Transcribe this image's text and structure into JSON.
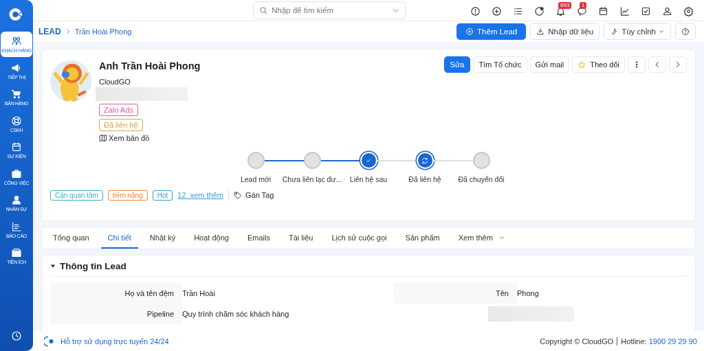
{
  "sidebar": {
    "items": [
      {
        "label": "KHÁCH HÀNG",
        "selected": true
      },
      {
        "label": "TIẾP THỊ",
        "selected": false
      },
      {
        "label": "BÁN HÀNG",
        "selected": false
      },
      {
        "label": "CSKH",
        "selected": false
      },
      {
        "label": "SỰ KIỆN",
        "selected": false
      },
      {
        "label": "CÔNG VIỆC",
        "selected": false
      },
      {
        "label": "NHÂN SỰ",
        "selected": false
      },
      {
        "label": "BÁO CÁO",
        "selected": false
      },
      {
        "label": "TIỆN ÍCH",
        "selected": false
      }
    ]
  },
  "search": {
    "placeholder": "Nhập để tìm kiếm"
  },
  "toolbar": {
    "notification_count": "693",
    "message_count": "1"
  },
  "breadcrumb": {
    "root": "LEAD",
    "current": "Trần Hoài Phong"
  },
  "page_actions": [
    {
      "label": "Thêm Lead",
      "kind": "primary"
    },
    {
      "label": "Nhập dữ liệu",
      "kind": "plain"
    },
    {
      "label": "Tùy chỉnh",
      "kind": "menu"
    },
    {
      "kind": "help"
    }
  ],
  "lead": {
    "name": "Anh Trần Hoài Phong",
    "company": "CloudGO",
    "badges": [
      {
        "label": "Zalo Ads",
        "color": "#d9609a"
      },
      {
        "label": "Đã liên hệ",
        "color": "#d9a441"
      }
    ],
    "map_link": "Xem bản đồ",
    "actions": [
      {
        "label": "Sửa",
        "kind": "primary"
      },
      {
        "label": "Tìm Tổ chức",
        "kind": "plain"
      },
      {
        "label": "Gửi mail",
        "kind": "plain"
      },
      {
        "label": "Theo dõi",
        "kind": "star"
      },
      {
        "kind": "more"
      },
      {
        "kind": "prev"
      },
      {
        "kind": "next"
      }
    ],
    "stages": [
      {
        "label": "Lead mới",
        "kind": "passed"
      },
      {
        "label": "Chưa liên lạc đư...",
        "kind": "passed"
      },
      {
        "label": "Liên hệ sau",
        "kind": "checked"
      },
      {
        "label": "Đã liên hệ",
        "kind": "active"
      },
      {
        "label": "Đã chuyển đổi",
        "kind": "pending"
      }
    ],
    "tags": [
      {
        "label": "Cần quan tâm",
        "color": "#3bb4b8"
      },
      {
        "label": "tiềm năng",
        "color": "#f08a3c"
      },
      {
        "label": "Hot",
        "color": "#3a9ec2"
      }
    ],
    "more_tags": "12  xem thêm",
    "assign_tag": "Gán Tag"
  },
  "tabs": [
    {
      "label": "Tổng quan",
      "kind": "tab",
      "selected": false
    },
    {
      "label": "Chi tiết",
      "kind": "tab",
      "selected": true
    },
    {
      "label": "Nhật ký",
      "kind": "tab",
      "selected": false
    },
    {
      "label": "Hoạt động",
      "kind": "tab",
      "selected": false
    },
    {
      "label": "Emails",
      "kind": "tab",
      "selected": false
    },
    {
      "label": "Tài liệu",
      "kind": "tab",
      "selected": false
    },
    {
      "label": "Lịch sử cuộc gọi",
      "kind": "tab",
      "selected": false
    },
    {
      "label": "Sản phẩm",
      "kind": "tab",
      "selected": false
    },
    {
      "label": "Xem thêm",
      "kind": "menu",
      "selected": false
    }
  ],
  "section": {
    "title": "Thông tin Lead",
    "expanded": true,
    "left": [
      {
        "label": "Họ và tên đệm",
        "value": "Trần Hoài",
        "kind": "field"
      },
      {
        "label": "Pipeline",
        "value": "Quy trình chăm sóc khách hàng",
        "kind": "field"
      }
    ],
    "right": [
      {
        "label": "Tên",
        "value": "Phong",
        "kind": "field"
      },
      {
        "kind": "redacted"
      }
    ]
  },
  "footer": {
    "support": "Hỗ trợ sử dụng trực tuyến 24/24",
    "copyright": "Copyright © CloudGO",
    "hotline_label": "Hotline:",
    "hotline": "1900 29 29 90"
  }
}
